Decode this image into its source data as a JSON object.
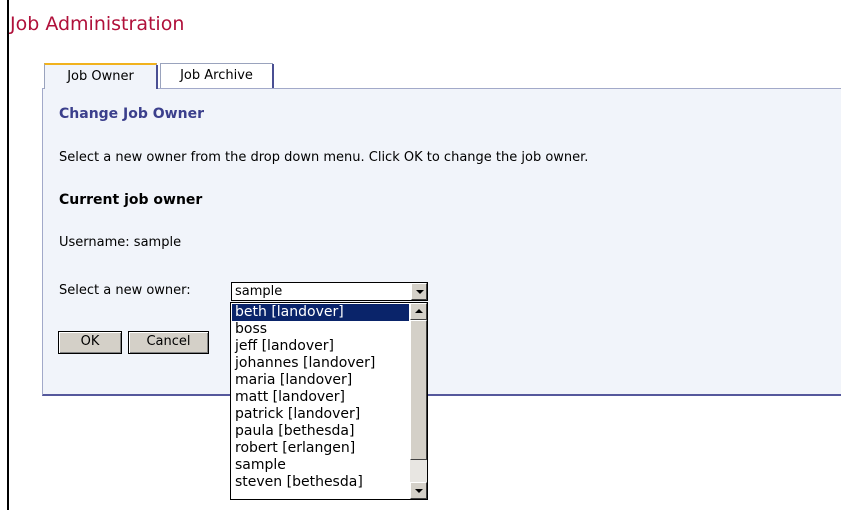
{
  "page": {
    "title": "Job Administration"
  },
  "tabs": [
    {
      "label": "Job Owner",
      "active": true
    },
    {
      "label": "Job Archive",
      "active": false
    }
  ],
  "panel": {
    "heading": "Change Job Owner",
    "instructions": "Select a new owner from the drop down menu. Click OK to change the job owner.",
    "current_owner_heading": "Current job owner",
    "username_label": "Username:",
    "username_value": "sample",
    "select_label": "Select a new owner:",
    "select_value": "sample"
  },
  "dropdown": {
    "options": [
      "beth [landover]",
      "boss",
      "jeff [landover]",
      "johannes [landover]",
      "maria [landover]",
      "matt [landover]",
      "patrick [landover]",
      "paula [bethesda]",
      "robert [erlangen]",
      "sample",
      "steven [bethesda]"
    ],
    "highlighted": "beth [landover]"
  },
  "buttons": {
    "ok": "OK",
    "cancel": "Cancel"
  },
  "colors": {
    "title": "#b0103a",
    "heading": "#3b3f8c",
    "panel_bg": "#f1f4fa",
    "highlight": "#0a246a"
  },
  "icons": {
    "select_arrow": "chevron-down-icon",
    "scroll_up": "scroll-up-icon",
    "scroll_down": "scroll-down-icon"
  }
}
